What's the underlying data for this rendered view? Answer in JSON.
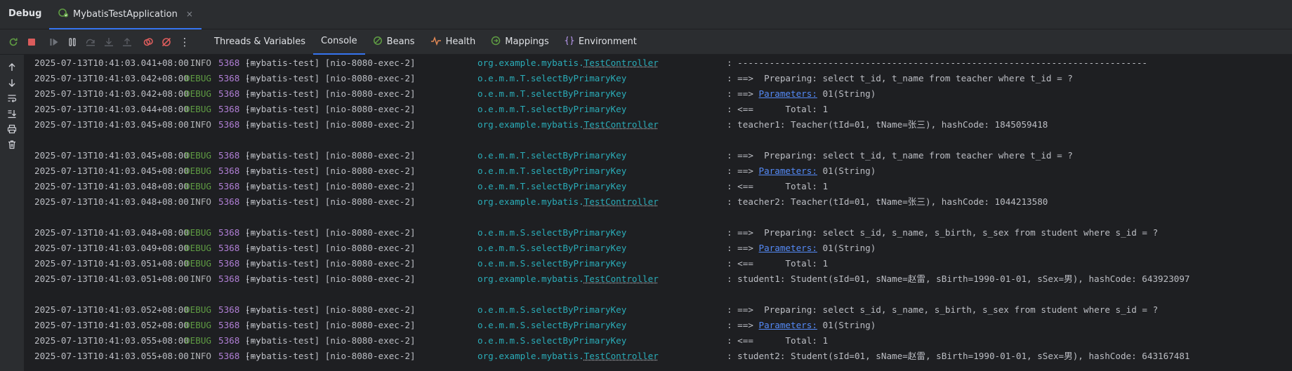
{
  "titlebar": {
    "title": "Debug",
    "run_tab": "MybatisTestApplication",
    "close_glyph": "×"
  },
  "toolbar": {
    "icons": [
      "rerun-icon",
      "stop-icon",
      "resume-icon",
      "pause-icon",
      "step-over-icon",
      "step-into-icon",
      "step-out-icon",
      "view-breakpoints-icon",
      "mute-breakpoints-icon",
      "more-icon"
    ],
    "more_glyph": "⋮",
    "tabs": [
      {
        "label": "Threads & Variables",
        "icon": "",
        "active": false
      },
      {
        "label": "Console",
        "icon": "",
        "active": true
      },
      {
        "label": "Beans",
        "icon": "beans-icon",
        "active": false
      },
      {
        "label": "Health",
        "icon": "health-icon",
        "active": false
      },
      {
        "label": "Mappings",
        "icon": "mappings-icon",
        "active": false
      },
      {
        "label": "Environment",
        "icon": "environment-icon",
        "active": false
      }
    ]
  },
  "sidebar": {
    "icons": [
      "scroll-up-icon",
      "scroll-down-icon",
      "soft-wrap-icon",
      "scroll-to-end-icon",
      "print-icon",
      "clear-all-icon"
    ]
  },
  "colors": {
    "accent": "#3574f0",
    "debug": "#5f9c43",
    "pid": "#b17fd6",
    "logger": "#2aacb8",
    "link": "#548af7"
  },
  "log": {
    "sep": "---",
    "app": "[mybatis-test]",
    "msg_sep": ":",
    "lines": [
      {
        "ts": "2025-07-13T10:41:03.041+08:00",
        "level": "INFO",
        "pid": "5368",
        "thread": "[nio-8080-exec-2]",
        "logger_pre": "org.example.mybatis.",
        "logger_ul": "TestController",
        "msg_pre": "-----------------------------------------------------------------------------",
        "msg_link": "",
        "msg_post": ""
      },
      {
        "ts": "2025-07-13T10:41:03.042+08:00",
        "level": "DEBUG",
        "pid": "5368",
        "thread": "[nio-8080-exec-2]",
        "logger_pre": "o.e.m.m.T.selectByPrimaryKey",
        "logger_ul": "",
        "msg_pre": "==>  Preparing: select t_id, t_name from teacher where t_id = ?",
        "msg_link": "",
        "msg_post": ""
      },
      {
        "ts": "2025-07-13T10:41:03.042+08:00",
        "level": "DEBUG",
        "pid": "5368",
        "thread": "[nio-8080-exec-2]",
        "logger_pre": "o.e.m.m.T.selectByPrimaryKey",
        "logger_ul": "",
        "msg_pre": "==> ",
        "msg_link": "Parameters:",
        "msg_post": " 01(String)"
      },
      {
        "ts": "2025-07-13T10:41:03.044+08:00",
        "level": "DEBUG",
        "pid": "5368",
        "thread": "[nio-8080-exec-2]",
        "logger_pre": "o.e.m.m.T.selectByPrimaryKey",
        "logger_ul": "",
        "msg_pre": "<==      Total: 1",
        "msg_link": "",
        "msg_post": ""
      },
      {
        "ts": "2025-07-13T10:41:03.045+08:00",
        "level": "INFO",
        "pid": "5368",
        "thread": "[nio-8080-exec-2]",
        "logger_pre": "org.example.mybatis.",
        "logger_ul": "TestController",
        "msg_pre": "teacher1: Teacher(tId=01, tName=张三), hashCode: 1845059418",
        "msg_link": "",
        "msg_post": ""
      },
      {
        "blank": true
      },
      {
        "ts": "2025-07-13T10:41:03.045+08:00",
        "level": "DEBUG",
        "pid": "5368",
        "thread": "[nio-8080-exec-2]",
        "logger_pre": "o.e.m.m.T.selectByPrimaryKey",
        "logger_ul": "",
        "msg_pre": "==>  Preparing: select t_id, t_name from teacher where t_id = ?",
        "msg_link": "",
        "msg_post": ""
      },
      {
        "ts": "2025-07-13T10:41:03.045+08:00",
        "level": "DEBUG",
        "pid": "5368",
        "thread": "[nio-8080-exec-2]",
        "logger_pre": "o.e.m.m.T.selectByPrimaryKey",
        "logger_ul": "",
        "msg_pre": "==> ",
        "msg_link": "Parameters:",
        "msg_post": " 01(String)"
      },
      {
        "ts": "2025-07-13T10:41:03.048+08:00",
        "level": "DEBUG",
        "pid": "5368",
        "thread": "[nio-8080-exec-2]",
        "logger_pre": "o.e.m.m.T.selectByPrimaryKey",
        "logger_ul": "",
        "msg_pre": "<==      Total: 1",
        "msg_link": "",
        "msg_post": ""
      },
      {
        "ts": "2025-07-13T10:41:03.048+08:00",
        "level": "INFO",
        "pid": "5368",
        "thread": "[nio-8080-exec-2]",
        "logger_pre": "org.example.mybatis.",
        "logger_ul": "TestController",
        "msg_pre": "teacher2: Teacher(tId=01, tName=张三), hashCode: 1044213580",
        "msg_link": "",
        "msg_post": ""
      },
      {
        "blank": true
      },
      {
        "ts": "2025-07-13T10:41:03.048+08:00",
        "level": "DEBUG",
        "pid": "5368",
        "thread": "[nio-8080-exec-2]",
        "logger_pre": "o.e.m.m.S.selectByPrimaryKey",
        "logger_ul": "",
        "msg_pre": "==>  Preparing: select s_id, s_name, s_birth, s_sex from student where s_id = ?",
        "msg_link": "",
        "msg_post": ""
      },
      {
        "ts": "2025-07-13T10:41:03.049+08:00",
        "level": "DEBUG",
        "pid": "5368",
        "thread": "[nio-8080-exec-2]",
        "logger_pre": "o.e.m.m.S.selectByPrimaryKey",
        "logger_ul": "",
        "msg_pre": "==> ",
        "msg_link": "Parameters:",
        "msg_post": " 01(String)"
      },
      {
        "ts": "2025-07-13T10:41:03.051+08:00",
        "level": "DEBUG",
        "pid": "5368",
        "thread": "[nio-8080-exec-2]",
        "logger_pre": "o.e.m.m.S.selectByPrimaryKey",
        "logger_ul": "",
        "msg_pre": "<==      Total: 1",
        "msg_link": "",
        "msg_post": ""
      },
      {
        "ts": "2025-07-13T10:41:03.051+08:00",
        "level": "INFO",
        "pid": "5368",
        "thread": "[nio-8080-exec-2]",
        "logger_pre": "org.example.mybatis.",
        "logger_ul": "TestController",
        "msg_pre": "student1: Student(sId=01, sName=赵雷, sBirth=1990-01-01, sSex=男), hashCode: 643923097",
        "msg_link": "",
        "msg_post": ""
      },
      {
        "blank": true
      },
      {
        "ts": "2025-07-13T10:41:03.052+08:00",
        "level": "DEBUG",
        "pid": "5368",
        "thread": "[nio-8080-exec-2]",
        "logger_pre": "o.e.m.m.S.selectByPrimaryKey",
        "logger_ul": "",
        "msg_pre": "==>  Preparing: select s_id, s_name, s_birth, s_sex from student where s_id = ?",
        "msg_link": "",
        "msg_post": ""
      },
      {
        "ts": "2025-07-13T10:41:03.052+08:00",
        "level": "DEBUG",
        "pid": "5368",
        "thread": "[nio-8080-exec-2]",
        "logger_pre": "o.e.m.m.S.selectByPrimaryKey",
        "logger_ul": "",
        "msg_pre": "==> ",
        "msg_link": "Parameters:",
        "msg_post": " 01(String)"
      },
      {
        "ts": "2025-07-13T10:41:03.055+08:00",
        "level": "DEBUG",
        "pid": "5368",
        "thread": "[nio-8080-exec-2]",
        "logger_pre": "o.e.m.m.S.selectByPrimaryKey",
        "logger_ul": "",
        "msg_pre": "<==      Total: 1",
        "msg_link": "",
        "msg_post": ""
      },
      {
        "ts": "2025-07-13T10:41:03.055+08:00",
        "level": "INFO",
        "pid": "5368",
        "thread": "[nio-8080-exec-2]",
        "logger_pre": "org.example.mybatis.",
        "logger_ul": "TestController",
        "msg_pre": "student2: Student(sId=01, sName=赵雷, sBirth=1990-01-01, sSex=男), hashCode: 643167481",
        "msg_link": "",
        "msg_post": ""
      }
    ]
  }
}
